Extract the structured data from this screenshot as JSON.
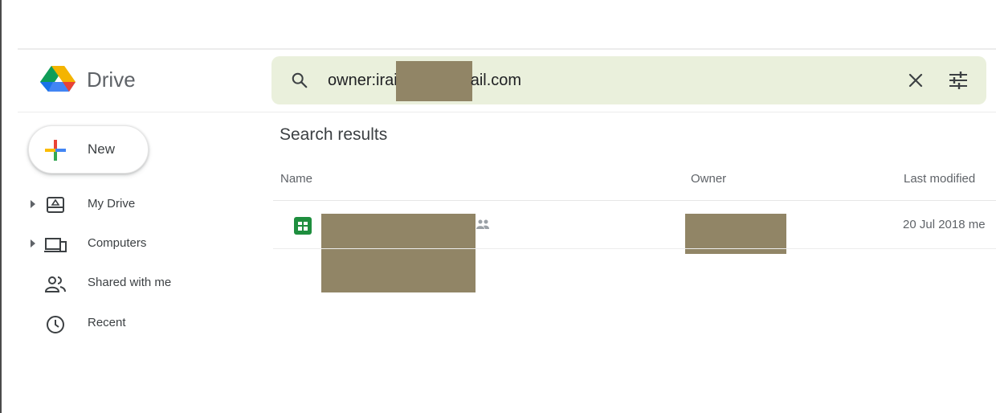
{
  "app": {
    "name": "Drive"
  },
  "search": {
    "query_prefix": "owner:irai",
    "query_suffix": "ail.com"
  },
  "sidebar": {
    "new_label": "New",
    "items": [
      {
        "label": "My Drive",
        "icon": "my-drive-icon",
        "expandable": true
      },
      {
        "label": "Computers",
        "icon": "computers-icon",
        "expandable": true
      },
      {
        "label": "Shared with me",
        "icon": "shared-with-me-icon",
        "expandable": false
      },
      {
        "label": "Recent",
        "icon": "clock-icon",
        "expandable": false
      }
    ]
  },
  "main": {
    "title": "Search results",
    "columns": {
      "name": "Name",
      "owner": "Owner",
      "modified": "Last modified"
    },
    "rows": [
      {
        "type_icon": "google-sheets-icon",
        "modified": "20 Jul 2018 me",
        "shared": true
      }
    ]
  },
  "colors": {
    "search_bg": "#eaf0dc",
    "redaction": "#918566",
    "sheets_green": "#1e8e3e"
  }
}
